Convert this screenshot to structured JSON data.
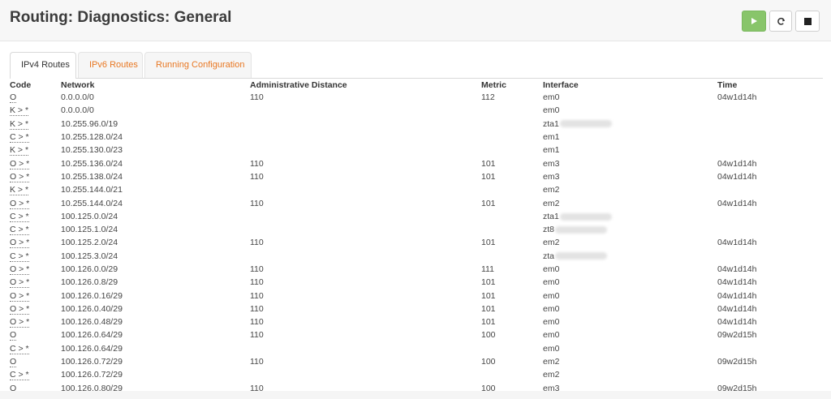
{
  "header": {
    "title": "Routing: Diagnostics: General"
  },
  "toolbar": {
    "start_icon": "play-icon",
    "restart_icon": "refresh-icon",
    "stop_icon": "stop-icon",
    "start_color": "#88c56a"
  },
  "tabs": [
    {
      "label": "IPv4 Routes",
      "active": true
    },
    {
      "label": "IPv6 Routes",
      "active": false
    },
    {
      "label": "Running Configuration",
      "active": false
    }
  ],
  "table": {
    "headers": [
      "Code",
      "Network",
      "Administrative Distance",
      "Metric",
      "Interface",
      "Time"
    ],
    "rows": [
      {
        "code": "O",
        "network": "0.0.0.0/0",
        "distance": "110",
        "metric": "112",
        "interface": "em0",
        "time": "04w1d14h"
      },
      {
        "code": "K > *",
        "network": "0.0.0.0/0",
        "distance": "",
        "metric": "",
        "interface": "em0",
        "time": ""
      },
      {
        "code": "K > *",
        "network": "10.255.96.0/19",
        "distance": "",
        "metric": "",
        "interface": "zta1",
        "time": ""
      },
      {
        "code": "C > *",
        "network": "10.255.128.0/24",
        "distance": "",
        "metric": "",
        "interface": "em1",
        "time": ""
      },
      {
        "code": "K > *",
        "network": "10.255.130.0/23",
        "distance": "",
        "metric": "",
        "interface": "em1",
        "time": ""
      },
      {
        "code": "O > *",
        "network": "10.255.136.0/24",
        "distance": "110",
        "metric": "101",
        "interface": "em3",
        "time": "04w1d14h"
      },
      {
        "code": "O > *",
        "network": "10.255.138.0/24",
        "distance": "110",
        "metric": "101",
        "interface": "em3",
        "time": "04w1d14h"
      },
      {
        "code": "K > *",
        "network": "10.255.144.0/21",
        "distance": "",
        "metric": "",
        "interface": "em2",
        "time": ""
      },
      {
        "code": "O > *",
        "network": "10.255.144.0/24",
        "distance": "110",
        "metric": "101",
        "interface": "em2",
        "time": "04w1d14h"
      },
      {
        "code": "C > *",
        "network": "100.125.0.0/24",
        "distance": "",
        "metric": "",
        "interface": "zta1",
        "time": ""
      },
      {
        "code": "C > *",
        "network": "100.125.1.0/24",
        "distance": "",
        "metric": "",
        "interface": "zt8",
        "time": ""
      },
      {
        "code": "O > *",
        "network": "100.125.2.0/24",
        "distance": "110",
        "metric": "101",
        "interface": "em2",
        "time": "04w1d14h"
      },
      {
        "code": "C > *",
        "network": "100.125.3.0/24",
        "distance": "",
        "metric": "",
        "interface": "zta",
        "time": ""
      },
      {
        "code": "O > *",
        "network": "100.126.0.0/29",
        "distance": "110",
        "metric": "111",
        "interface": "em0",
        "time": "04w1d14h"
      },
      {
        "code": "O > *",
        "network": "100.126.0.8/29",
        "distance": "110",
        "metric": "101",
        "interface": "em0",
        "time": "04w1d14h"
      },
      {
        "code": "O > *",
        "network": "100.126.0.16/29",
        "distance": "110",
        "metric": "101",
        "interface": "em0",
        "time": "04w1d14h"
      },
      {
        "code": "O > *",
        "network": "100.126.0.40/29",
        "distance": "110",
        "metric": "101",
        "interface": "em0",
        "time": "04w1d14h"
      },
      {
        "code": "O > *",
        "network": "100.126.0.48/29",
        "distance": "110",
        "metric": "101",
        "interface": "em0",
        "time": "04w1d14h"
      },
      {
        "code": "O",
        "network": "100.126.0.64/29",
        "distance": "110",
        "metric": "100",
        "interface": "em0",
        "time": "09w2d15h"
      },
      {
        "code": "C > *",
        "network": "100.126.0.64/29",
        "distance": "",
        "metric": "",
        "interface": "em0",
        "time": ""
      },
      {
        "code": "O",
        "network": "100.126.0.72/29",
        "distance": "110",
        "metric": "100",
        "interface": "em2",
        "time": "09w2d15h"
      },
      {
        "code": "C > *",
        "network": "100.126.0.72/29",
        "distance": "",
        "metric": "",
        "interface": "em2",
        "time": ""
      },
      {
        "code": "O",
        "network": "100.126.0.80/29",
        "distance": "110",
        "metric": "100",
        "interface": "em3",
        "time": "09w2d15h"
      }
    ]
  }
}
